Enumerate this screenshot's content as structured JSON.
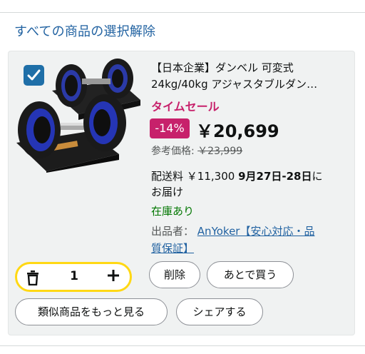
{
  "header": {
    "deselect_all": "すべての商品の選択解除"
  },
  "item": {
    "title_line1": "【日本企業】ダンベル 可変式",
    "title_line2": "24kg/40kg アジャスタブルダン…",
    "deal_label": "タイムセール",
    "discount": "-14%",
    "price": "￥20,699",
    "ref_label": "参考価格:",
    "ref_price": "￥23,999",
    "shipping_label": "配送料",
    "shipping_fee": "￥11,300",
    "delivery_date": "9月27日-28日",
    "delivery_suffix1": "に",
    "delivery_suffix2": "お届け",
    "stock": "在庫あり",
    "seller_label": "出品者：",
    "seller_line1": "AnYoker【安心対応・品",
    "seller_line2": "質保証】",
    "quantity": "1"
  },
  "actions": {
    "delete": "削除",
    "save_later": "あとで買う",
    "similar": "類似商品をもっと見る",
    "share": "シェアする"
  },
  "icons": [
    "checkbox-checked-icon",
    "trash-icon",
    "plus-icon"
  ],
  "colors": {
    "link": "#2162a1",
    "deal": "#c7216b",
    "stock": "#007600",
    "qty_border": "#ffd814",
    "checkbox": "#1f6fa8"
  }
}
